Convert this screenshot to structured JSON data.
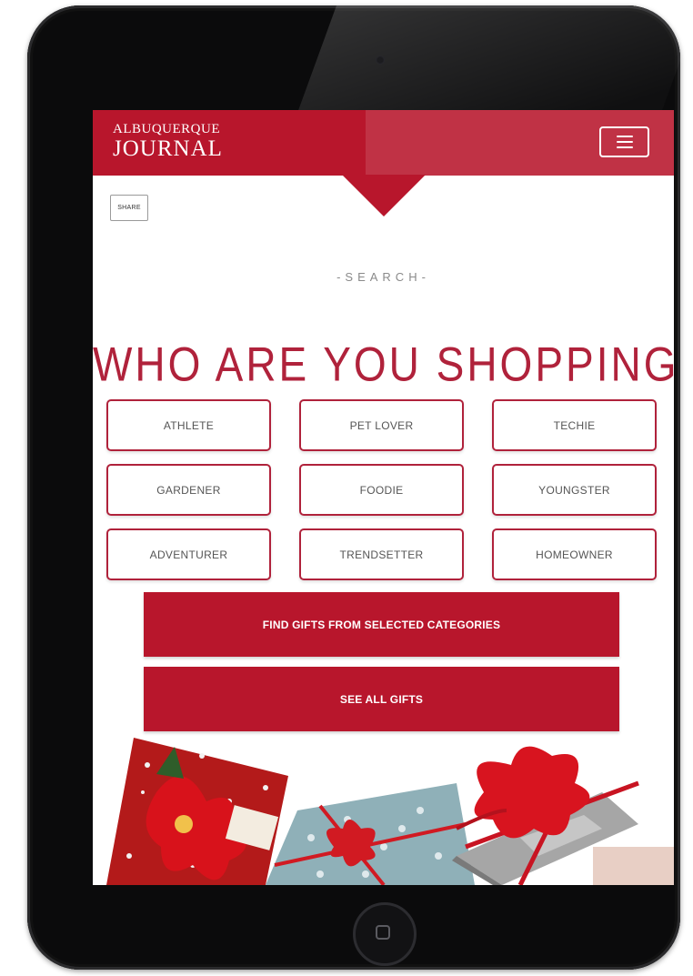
{
  "header": {
    "logo_top": "ALBUQUERQUE",
    "logo_bottom": "JOURNAL"
  },
  "share_label": "SHARE",
  "search_label": "-SEARCH-",
  "headline": "WHO ARE YOU SHOPPING FOR?",
  "categories": [
    {
      "label": "ATHLETE"
    },
    {
      "label": "PET LOVER"
    },
    {
      "label": "TECHIE"
    },
    {
      "label": "GARDENER"
    },
    {
      "label": "FOODIE"
    },
    {
      "label": "YOUNGSTER"
    },
    {
      "label": "ADVENTURER"
    },
    {
      "label": "TRENDSETTER"
    },
    {
      "label": "HOMEOWNER"
    }
  ],
  "find_button_label": "FIND GIFTS FROM SELECTED CATEGORIES",
  "see_all_button_label": "SEE ALL GIFTS",
  "colors": {
    "brand_red": "#b8162c",
    "outline_red": "#b0223b",
    "device_black": "#0b0b0c"
  },
  "icons": {
    "menu": "hamburger-menu-icon",
    "home": "home-button-icon"
  }
}
